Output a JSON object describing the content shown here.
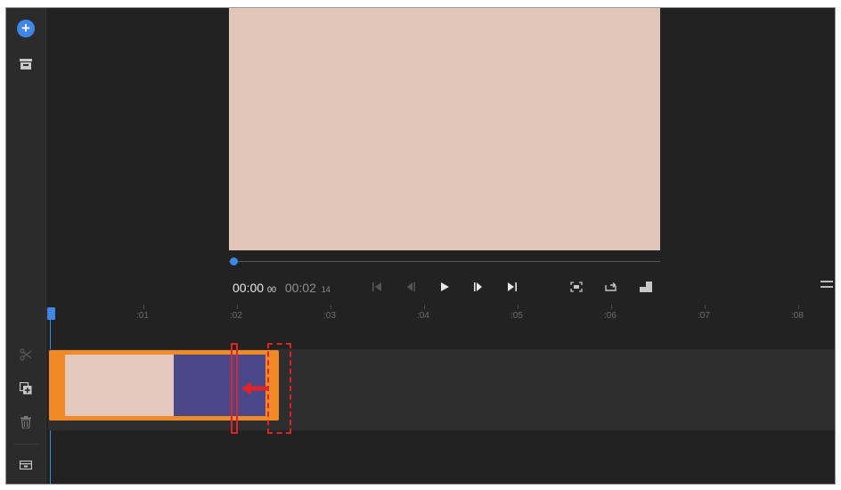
{
  "playback": {
    "current_time": "00:00",
    "current_frames": "00",
    "duration": "00:02",
    "duration_frames": "14"
  },
  "timeline": {
    "ruler_labels": [
      ":01",
      ":02",
      ":03",
      ":04",
      ":05",
      ":06",
      ":07",
      ":08"
    ]
  },
  "colors": {
    "accent": "#3f86e6",
    "clip_border": "#f08a29",
    "clip_thumb_1": "#e4c8bd",
    "clip_thumb_2": "#4b4888",
    "preview": "#e2c5b9",
    "annotation": "#e12228"
  }
}
